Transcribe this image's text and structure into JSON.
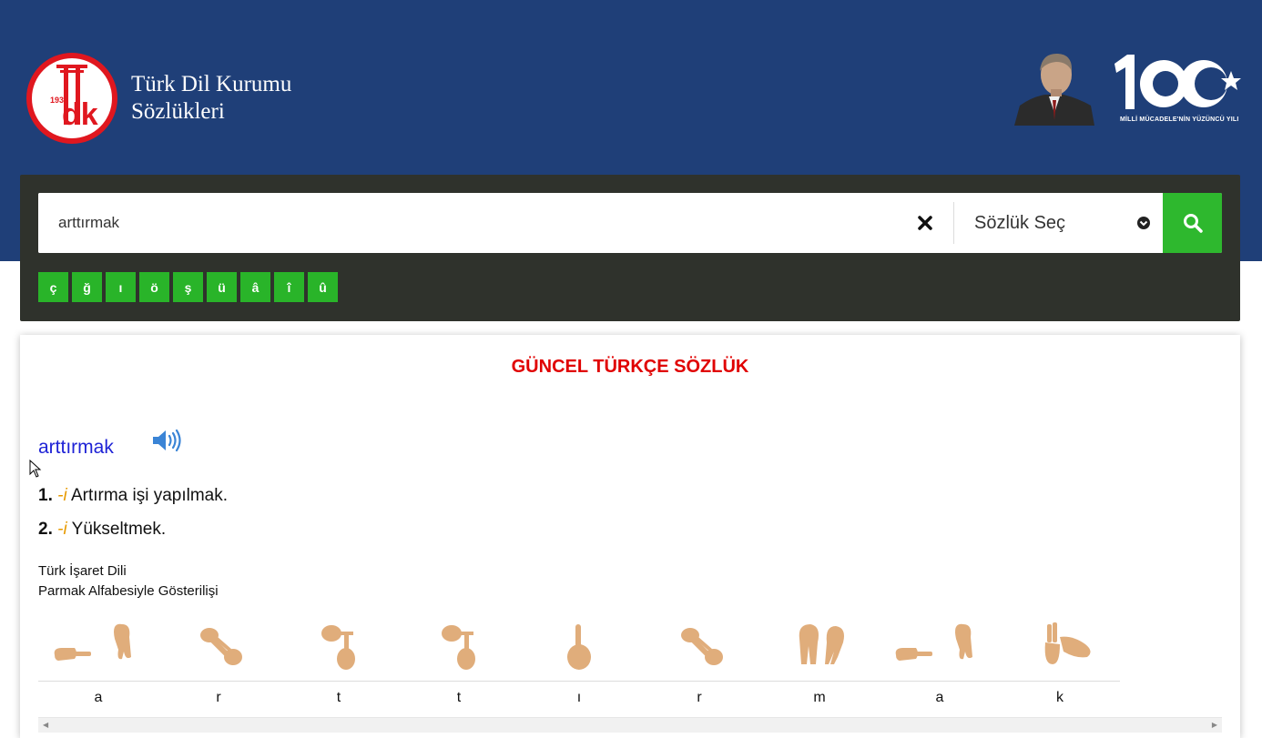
{
  "header": {
    "logo_year": "1932",
    "logo_line1": "Türk Dil Kurumu",
    "logo_line2": "Sözlükleri",
    "centennial_number": "100",
    "centennial_caption": "MİLLİ MÜCADELE'NİN YÜZÜNCÜ YILI"
  },
  "search": {
    "query": "arttırmak",
    "dictionary_select": "Sözlük Seç",
    "special_letters": [
      "ç",
      "ğ",
      "ı",
      "ö",
      "ş",
      "ü",
      "â",
      "î",
      "û"
    ]
  },
  "result": {
    "dictionary_title": "GÜNCEL TÜRKÇE SÖZLÜK",
    "headword": "arttırmak",
    "meanings": [
      {
        "num": "1.",
        "gram": "-i",
        "text": "Artırma işi yapılmak."
      },
      {
        "num": "2.",
        "gram": "-i",
        "text": "Yükseltmek."
      }
    ],
    "sign_language_line1": "Türk İşaret Dili",
    "sign_language_line2": "Parmak Alfabesiyle Gösterilişi",
    "sign_letters": [
      "a",
      "r",
      "t",
      "t",
      "ı",
      "r",
      "m",
      "a",
      "k"
    ]
  },
  "colors": {
    "header_bg": "#1f3f78",
    "panel_bg": "#2f322c",
    "green": "#2eb82e",
    "title_red": "#e00000",
    "headword_blue": "#1f23d6",
    "gram_orange": "#e79a00",
    "skin": "#e0ad7b"
  }
}
